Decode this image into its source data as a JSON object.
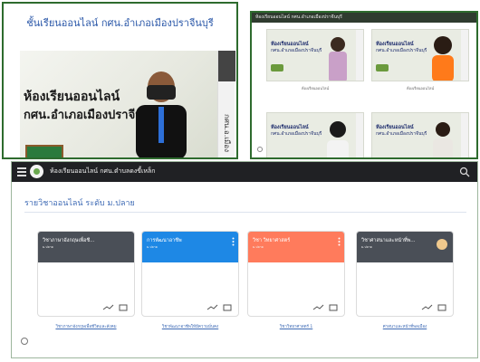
{
  "top_left": {
    "header_title": "ชั้นเรียนออนไลน์ กศน.อำเภอเมืองปราจีนบุรี",
    "banner_line1": "ห้องเรียนออนไลน์",
    "banner_line2": "กศน.อำเภอเมืองปราจีนบุรี",
    "sidebar_text": "กศน.อ.เมือง"
  },
  "top_right": {
    "title": "ห้องเรียนออนไลน์ กศน.อำเภอเมืองปราจีนบุรี",
    "thumbs": [
      {
        "line1": "ห้องเรียนออนไลน์",
        "line2": "กศน.อำเภอเมืองปราจีนบุรี",
        "caption": "ห้องเรียนออนไลน์"
      },
      {
        "line1": "ห้องเรียนออนไลน์",
        "line2": "กศน.อำเภอเมืองปราจีนบุรี",
        "caption": "ห้องเรียนออนไลน์"
      },
      {
        "line1": "ห้องเรียนออนไลน์",
        "line2": "กศน.อำเภอเมืองปราจีนบุรี",
        "caption": ""
      },
      {
        "line1": "ห้องเรียนออนไลน์",
        "line2": "กศน.อำเภอเมืองปราจีนบุรี",
        "caption": ""
      }
    ]
  },
  "bottom": {
    "app_title": "ห้องเรียนออนไลน์ กศน.ตำบลดงขี้เหล็ก",
    "section_title": "รายวิชาออนไลน์ ระดับ ม.ปลาย",
    "cards": [
      {
        "title": "วิชาภาษาอังกฤษเพื่อชี...",
        "sub": "ม.ปลาย",
        "color": "#4a4f57",
        "link": "วิชาภาษาอังกฤษเพื่อชีวิตและสังคม"
      },
      {
        "title": "การพัฒนาอาชีพ",
        "sub": "ม.ปลาย",
        "color": "#1e88e5",
        "link": "วิชาพัฒนาอาชีพให้มีความมั่นคง"
      },
      {
        "title": "วิชา วิทยาศาสตร์",
        "sub": "ม.ปลาย",
        "color": "#ff7b5c",
        "link": "วิชาวิทยาศาสตร์ 1"
      },
      {
        "title": "วิชาศาสนาและหน้าที่พ...",
        "sub": "ม.ปลาย",
        "color": "#4a4f57",
        "link": "ศาสนาและหน้าที่พลเมือง"
      }
    ]
  },
  "icons": {
    "menu": "hamburger-icon",
    "search": "search-icon",
    "trend": "trending-icon",
    "folder": "folder-icon",
    "more": "more-vertical-icon",
    "help": "help-icon"
  }
}
